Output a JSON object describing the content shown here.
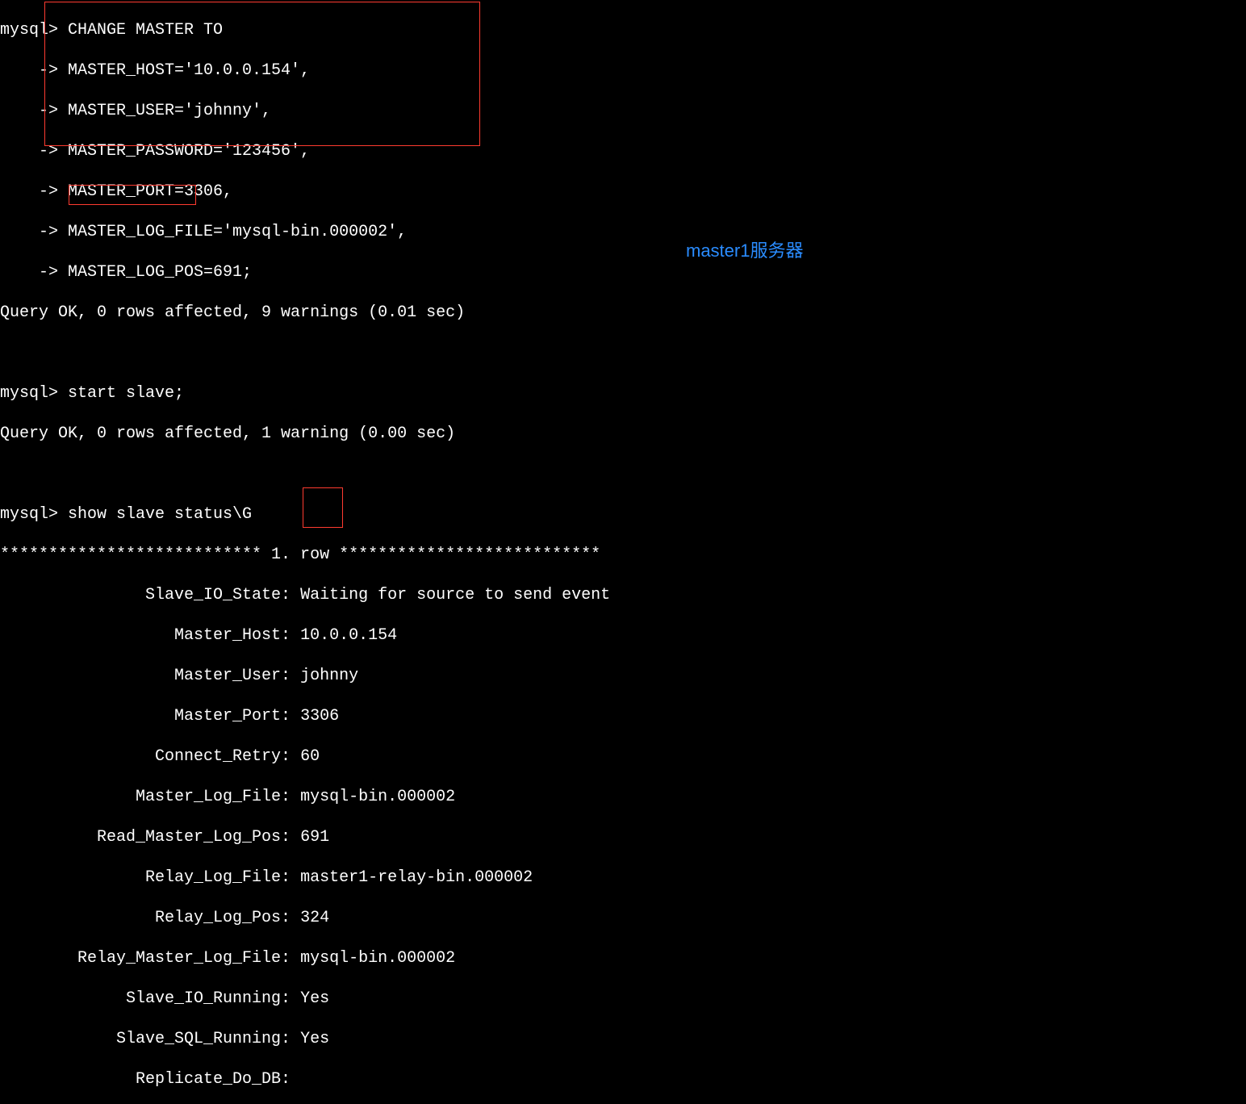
{
  "prompt": "mysql> ",
  "cont": "    -> ",
  "cmd1_l1": "CHANGE MASTER TO",
  "cmd1_l2": "MASTER_HOST='10.0.0.154',",
  "cmd1_l3": "MASTER_USER='johnny',",
  "cmd1_l4": "MASTER_PASSWORD='123456',",
  "cmd1_l5": "MASTER_PORT=3306,",
  "cmd1_l6": "MASTER_LOG_FILE='mysql-bin.000002',",
  "cmd1_l7": "MASTER_LOG_POS=691;",
  "result1": "Query OK, 0 rows affected, 9 warnings (0.01 sec)",
  "blank": " ",
  "cmd2": "start slave;",
  "result2": "Query OK, 0 rows affected, 1 warning (0.00 sec)",
  "cmd3": "show slave status\\G",
  "row_header": "*************************** 1. row ***************************",
  "status": {
    "k1": "               Slave_IO_State: ",
    "v1": "Waiting for source to send event",
    "k2": "                  Master_Host: ",
    "v2": "10.0.0.154",
    "k3": "                  Master_User: ",
    "v3": "johnny",
    "k4": "                  Master_Port: ",
    "v4": "3306",
    "k5": "                Connect_Retry: ",
    "v5": "60",
    "k6": "              Master_Log_File: ",
    "v6": "mysql-bin.000002",
    "k7": "          Read_Master_Log_Pos: ",
    "v7": "691",
    "k8": "               Relay_Log_File: ",
    "v8": "master1-relay-bin.000002",
    "k9": "                Relay_Log_Pos: ",
    "v9": "324",
    "k10": "        Relay_Master_Log_File: ",
    "v10": "mysql-bin.000002",
    "k11": "             Slave_IO_Running: ",
    "v11": "Yes",
    "k12": "            Slave_SQL_Running: ",
    "v12": "Yes",
    "k13": "              Replicate_Do_DB: ",
    "v13": ""
  },
  "annotation": "master1服务器"
}
